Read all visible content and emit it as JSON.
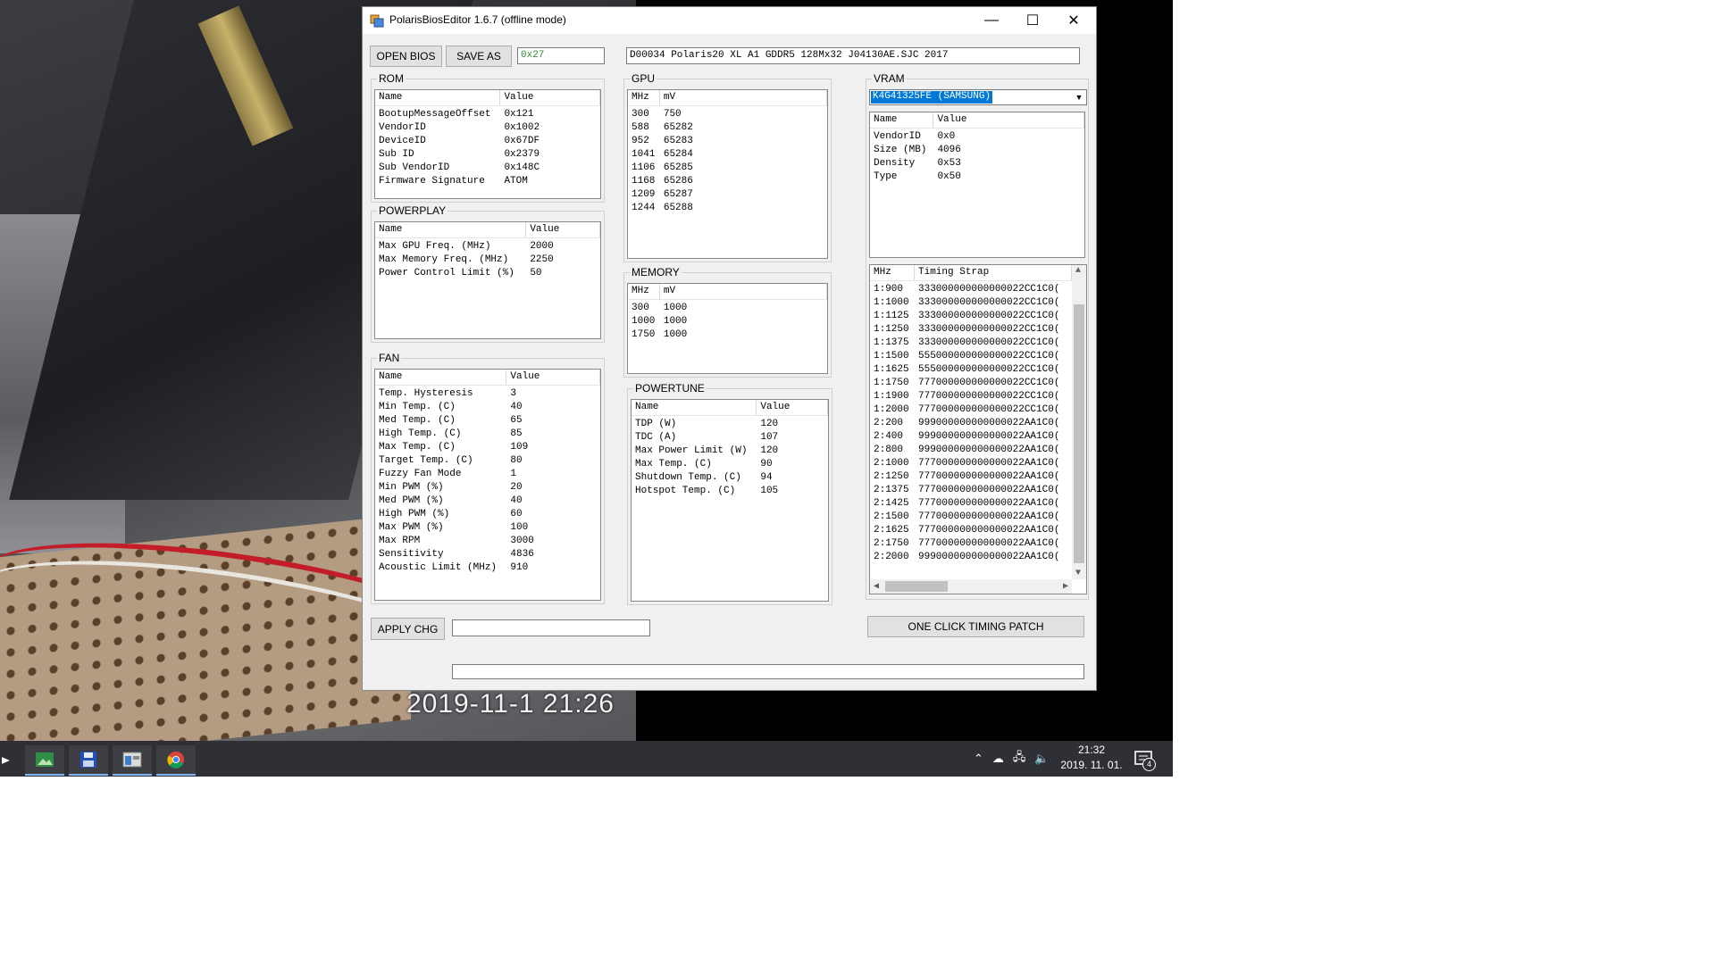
{
  "window": {
    "title": "PolarisBiosEditor 1.6.7 (offline mode)",
    "minimize_glyph": "—",
    "maximize_glyph": "☐",
    "close_glyph": "✕"
  },
  "toolbar": {
    "open_label": "OPEN BIOS",
    "save_label": "SAVE AS",
    "checksum_value": "0x27",
    "bios_info_value": "D00034 Polaris20 XL A1 GDDR5 128Mx32 J04130AE.SJC 2017"
  },
  "rom": {
    "title": "ROM",
    "headers": [
      "Name",
      "Value"
    ],
    "rows": [
      [
        "BootupMessageOffset",
        "0x121"
      ],
      [
        "VendorID",
        "0x1002"
      ],
      [
        "DeviceID",
        "0x67DF"
      ],
      [
        "Sub ID",
        "0x2379"
      ],
      [
        "Sub VendorID",
        "0x148C"
      ],
      [
        "Firmware Signature",
        "ATOM"
      ]
    ]
  },
  "powerplay": {
    "title": "POWERPLAY",
    "headers": [
      "Name",
      "Value"
    ],
    "rows": [
      [
        "Max GPU Freq. (MHz)",
        "2000"
      ],
      [
        "Max Memory Freq. (MHz)",
        "2250"
      ],
      [
        "Power Control Limit (%)",
        "50"
      ]
    ]
  },
  "fan": {
    "title": "FAN",
    "headers": [
      "Name",
      "Value"
    ],
    "rows": [
      [
        "Temp. Hysteresis",
        "3"
      ],
      [
        "Min Temp. (C)",
        "40"
      ],
      [
        "Med Temp. (C)",
        "65"
      ],
      [
        "High Temp. (C)",
        "85"
      ],
      [
        "Max Temp. (C)",
        "109"
      ],
      [
        "Target Temp. (C)",
        "80"
      ],
      [
        "Fuzzy Fan Mode",
        "1"
      ],
      [
        "Min PWM (%)",
        "20"
      ],
      [
        "Med PWM (%)",
        "40"
      ],
      [
        "High PWM (%)",
        "60"
      ],
      [
        "Max PWM (%)",
        "100"
      ],
      [
        "Max RPM",
        "3000"
      ],
      [
        "Sensitivity",
        "4836"
      ],
      [
        "Acoustic Limit (MHz)",
        "910"
      ]
    ]
  },
  "gpu": {
    "title": "GPU",
    "headers": [
      "MHz",
      "mV"
    ],
    "rows": [
      [
        "300",
        "750"
      ],
      [
        "588",
        "65282"
      ],
      [
        "952",
        "65283"
      ],
      [
        "1041",
        "65284"
      ],
      [
        "1106",
        "65285"
      ],
      [
        "1168",
        "65286"
      ],
      [
        "1209",
        "65287"
      ],
      [
        "1244",
        "65288"
      ]
    ]
  },
  "memory": {
    "title": "MEMORY",
    "headers": [
      "MHz",
      "mV"
    ],
    "rows": [
      [
        "300",
        "1000"
      ],
      [
        "1000",
        "1000"
      ],
      [
        "1750",
        "1000"
      ]
    ]
  },
  "powertune": {
    "title": "POWERTUNE",
    "headers": [
      "Name",
      "Value"
    ],
    "rows": [
      [
        "TDP (W)",
        "120"
      ],
      [
        "TDC (A)",
        "107"
      ],
      [
        "Max Power Limit (W)",
        "120"
      ],
      [
        "Max Temp. (C)",
        "90"
      ],
      [
        "Shutdown Temp. (C)",
        "94"
      ],
      [
        "Hotspot Temp. (C)",
        "105"
      ]
    ]
  },
  "vram": {
    "title": "VRAM",
    "selected": "K4G41325FE (SAMSUNG)",
    "headers": [
      "Name",
      "Value"
    ],
    "rows": [
      [
        "VendorID",
        "0x0"
      ],
      [
        "Size (MB)",
        "4096"
      ],
      [
        "Density",
        "0x53"
      ],
      [
        "Type",
        "0x50"
      ]
    ],
    "timing_headers": [
      "MHz",
      "Timing Strap"
    ],
    "timings": [
      [
        "1:900",
        "333000000000000022CC1C0("
      ],
      [
        "1:1000",
        "333000000000000022CC1C0("
      ],
      [
        "1:1125",
        "333000000000000022CC1C0("
      ],
      [
        "1:1250",
        "333000000000000022CC1C0("
      ],
      [
        "1:1375",
        "333000000000000022CC1C0("
      ],
      [
        "1:1500",
        "555000000000000022CC1C0("
      ],
      [
        "1:1625",
        "555000000000000022CC1C0("
      ],
      [
        "1:1750",
        "777000000000000022CC1C0("
      ],
      [
        "1:1900",
        "777000000000000022CC1C0("
      ],
      [
        "1:2000",
        "777000000000000022CC1C0("
      ],
      [
        "2:200",
        "999000000000000022AA1C0("
      ],
      [
        "2:400",
        "999000000000000022AA1C0("
      ],
      [
        "2:800",
        "999000000000000022AA1C0("
      ],
      [
        "2:1000",
        "777000000000000022AA1C0("
      ],
      [
        "2:1250",
        "777000000000000022AA1C0("
      ],
      [
        "2:1375",
        "777000000000000022AA1C0("
      ],
      [
        "2:1425",
        "777000000000000022AA1C0("
      ],
      [
        "2:1500",
        "777000000000000022AA1C0("
      ],
      [
        "2:1625",
        "777000000000000022AA1C0("
      ],
      [
        "2:1750",
        "777000000000000022AA1C0("
      ],
      [
        "2:2000",
        "999000000000000022AA1C0("
      ]
    ]
  },
  "bottom": {
    "apply_label": "APPLY CHG",
    "apply_field_value": "",
    "timing_patch_label": "ONE CLICK TIMING PATCH",
    "status_value": ""
  },
  "photo": {
    "timestamp": "2019-11-1 21:26"
  },
  "taskbar": {
    "time": "21:32",
    "date": "2019. 11. 01.",
    "notification_count": "4",
    "icons": [
      "mail-icon",
      "photos-icon",
      "save-disk-icon",
      "app-window-icon",
      "chrome-icon"
    ],
    "accent_color": "#7fb2f0"
  },
  "colors": {
    "selection": "#0078d7",
    "checksum_text": "#2e8b2e",
    "window_bg": "#f0f0f0"
  }
}
